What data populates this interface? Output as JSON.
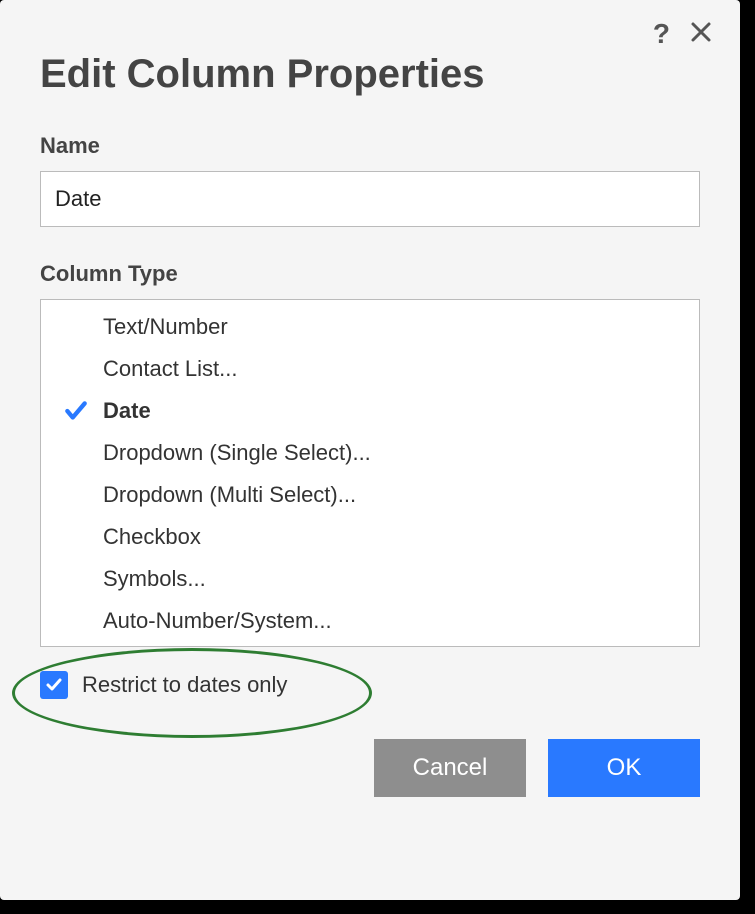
{
  "dialog": {
    "title": "Edit Column Properties"
  },
  "name_field": {
    "label": "Name",
    "value": "Date"
  },
  "type_field": {
    "label": "Column Type",
    "selected_index": 2,
    "options": [
      "Text/Number",
      "Contact List...",
      "Date",
      "Dropdown (Single Select)...",
      "Dropdown (Multi Select)...",
      "Checkbox",
      "Symbols...",
      "Auto-Number/System..."
    ]
  },
  "restrict_checkbox": {
    "label": "Restrict to dates only",
    "checked": true
  },
  "buttons": {
    "cancel": "Cancel",
    "ok": "OK"
  }
}
